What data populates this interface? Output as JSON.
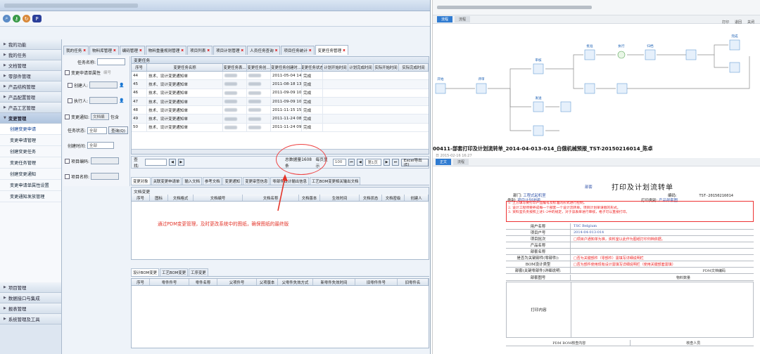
{
  "toolbar": {
    "icons": [
      "search-icon",
      "key-icon",
      "refresh-icon",
      "pdm-logo"
    ]
  },
  "nav": {
    "top_items": [
      "我的功能",
      "我的任务",
      "文档管理",
      "零部件管理",
      "产品结构管理",
      "产品配置管理",
      "产品工艺管理",
      "变更管理"
    ],
    "sub_items": [
      "创建变更申请",
      "变更申请管理",
      "创建变更任务",
      "变更任务管理",
      "创建变更通知",
      "变更申请单属性设置",
      "变更通知发放管理"
    ],
    "bottom_items": [
      "项目管理",
      "数据接口与集成",
      "报表管理",
      "系统管理及工具"
    ]
  },
  "tabs": [
    {
      "label": "我的任务",
      "active": false
    },
    {
      "label": "物料库管理",
      "active": false
    },
    {
      "label": "编码管理",
      "active": false
    },
    {
      "label": "物料重量规则管理",
      "active": false
    },
    {
      "label": "项目列表",
      "active": false
    },
    {
      "label": "项目计划管理",
      "active": false
    },
    {
      "label": "人员任务查询",
      "active": false
    },
    {
      "label": "项目任务统计",
      "active": false
    },
    {
      "label": "变更任务管理",
      "active": true
    }
  ],
  "filter": {
    "task_name_label": "任务名称:",
    "apply_attr_label": "变更申请单属性",
    "apply_attr_value": "编号",
    "creator_label": "创建人:",
    "executor_label": "执行人:",
    "notify_label": "变更通知:",
    "notify_value": "文档编",
    "include_label": "包含",
    "status_label": "任务状态:",
    "status_value": "全部",
    "query_label": "查询(Q)",
    "create_time_label": "创建时间:",
    "create_time_value": "全部",
    "project_code_label": "项目编码:",
    "project_name_label": "项目名称:"
  },
  "grid": {
    "section_title": "变更任务",
    "columns": [
      "序号",
      "变更任务名称",
      "变更任务表...",
      "变更任务创...",
      "变更任务创建时...",
      "变更任务状态",
      "计划开始时间",
      "计划完成时间",
      "实际开始时间",
      "实际完成时间"
    ],
    "rows": [
      {
        "no": "44",
        "name": "技术、设计变更通知单",
        "date": "2011-05-04 14...",
        "status": "完成"
      },
      {
        "no": "45",
        "name": "技术、设计变更通知单",
        "date": "2011-08-18 13...",
        "status": "完成"
      },
      {
        "no": "46",
        "name": "技术、设计变更通知单",
        "date": "2011-09-09 10...",
        "status": "完成"
      },
      {
        "no": "47",
        "name": "技术、设计变更通知单",
        "date": "2011-09-09 10...",
        "status": "完成"
      },
      {
        "no": "48",
        "name": "技术、设计变更通知单",
        "date": "2011-11-15 15...",
        "status": "完成"
      },
      {
        "no": "49",
        "name": "技术、设计变更通知单",
        "date": "2011-11-24 08...",
        "status": "完成"
      },
      {
        "no": "50",
        "name": "技术、设计变更通知单",
        "date": "2011-11-24 09...",
        "status": "完成"
      }
    ]
  },
  "pager": {
    "query_label": "查找:",
    "total_text": "总数据量1608条",
    "per_page_label": "每页显示",
    "per_page_value": "100",
    "page_value": "第1页",
    "excel_label": "Excel导出(E)"
  },
  "subtabs": [
    {
      "label": "变更对象",
      "active": true
    },
    {
      "label": "关联变更申请单",
      "active": false
    },
    {
      "label": "输入文档",
      "active": false
    },
    {
      "label": "参考文档",
      "active": false
    },
    {
      "label": "变更通知",
      "active": false
    },
    {
      "label": "变更审签信息",
      "active": false
    },
    {
      "label": "零部件设计输出信息",
      "active": false
    },
    {
      "label": "工艺BOM变更相关输出文档",
      "active": false
    }
  ],
  "doc_panel": {
    "title": "文档变更",
    "columns": [
      "序号",
      "图标",
      "文档格式",
      "文档编号",
      "文档名称",
      "文档版本",
      "生效时间",
      "文档状态",
      "文档密级",
      "创建人"
    ]
  },
  "annotation": "通过PDM变更管理，及时更改系统中的图纸，确保图纸的最终版",
  "bom_tabs": [
    {
      "label": "设计BOM变更",
      "active": true
    },
    {
      "label": "工艺BOM变更",
      "active": false
    },
    {
      "label": "工序变更",
      "active": false
    }
  ],
  "bom_panel": {
    "columns": [
      "序号",
      "零件件号",
      "零件名称",
      "父项件号",
      "父项版本",
      "父零件失效方式",
      "新零件失效时间",
      "旧零件件号",
      "旧零件名"
    ]
  },
  "workflow": {
    "tabs": [
      {
        "label": "流程",
        "active": true
      },
      {
        "label": "流程",
        "active": false
      }
    ],
    "tools": [
      "打印",
      "退回",
      "关闭"
    ],
    "nodes": [
      {
        "label": "开始"
      },
      {
        "label": "评审"
      },
      {
        "label": "审核"
      },
      {
        "label": "批准"
      },
      {
        "label": "执行"
      },
      {
        "label": "归档"
      },
      {
        "label": "完成"
      },
      {
        "label": "发送"
      }
    ]
  },
  "form": {
    "title_bar": "00411-部套打印及计划流转单_2014-04-013-014_白俄机械预报_TST-20150216014_陈卓",
    "date_line": "日 2015-02-16 16:27",
    "tabs": [
      {
        "label": "正文",
        "active": true
      },
      {
        "label": "流程",
        "active": false
      }
    ],
    "title": "打印及计划流转单",
    "title_prefix": "部套",
    "dept_label": "部门:",
    "dept_value": "工程式起机室",
    "code_label": "编码:",
    "code_value": "TST-20150216014",
    "category_label": "类别:",
    "category_value": "项目计划说明",
    "print_type_label": "打印类别:",
    "print_type_value": "产品部套图",
    "red_notes": [
      "1. 上方填写要打印产品编号及标准的形式进行控制。",
      "2. 设计工程师要养成每一个部套一个设计流转单。项目计划单请假的形式。",
      "3. 资料室负责按照上述1-2中的规定，对于该表单进行审核，格子可以直接打印。"
    ],
    "rows": [
      {
        "label": "用户名称",
        "value": "TSC Belgium"
      },
      {
        "label": "项目户号",
        "value": "2014-04-013-014"
      },
      {
        "label": "项目批次",
        "value": "□项目户通知单为准，资料室以此作为图纸打印归档依据。"
      },
      {
        "label": "产品名称",
        "value": ""
      },
      {
        "label": "部套名称",
        "value": ""
      },
      {
        "label": "是否为关键部件(零部件):",
        "value": "□否为关键部件（零部件）需填写详细说明栏"
      },
      {
        "label": "BOM设计类型",
        "value": "□否为部件使用现有设计需填写详细说明栏（使用关键部套需填）"
      },
      {
        "label": "部套(关键零部件)详细说明:",
        "value": ""
      }
    ],
    "pdm_code_label": "PDM文档编码",
    "part_no_label": "部套图号",
    "material_count_label": "物料数量",
    "print_content_label": "打印内容",
    "footer_left": "PDM BOM核查内容",
    "footer_right": "核查人员"
  },
  "colors": {
    "accent": "#2f7bd1",
    "annotation": "#e3352a",
    "nav_bg": "#dde6f1"
  }
}
